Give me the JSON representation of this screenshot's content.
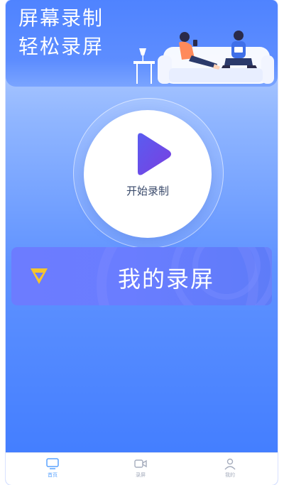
{
  "header": {
    "title_line1": "屏幕录制",
    "title_line2": "轻松录屏"
  },
  "record": {
    "label": "开始录制",
    "play_gradient_start": "#5a5cf0",
    "play_gradient_end": "#7a3fe0"
  },
  "my_recordings": {
    "label": "我的录屏",
    "icon": "diamond-icon",
    "icon_color": "#f6c52b"
  },
  "tabbar": {
    "tabs": [
      {
        "label": "首页",
        "icon": "tv-icon",
        "active": true
      },
      {
        "label": "录屏",
        "icon": "video-camera-icon",
        "active": false
      },
      {
        "label": "我的",
        "icon": "user-icon",
        "active": false
      }
    ],
    "active_color": "#5aa3ff",
    "inactive_color": "#a6adbd"
  }
}
